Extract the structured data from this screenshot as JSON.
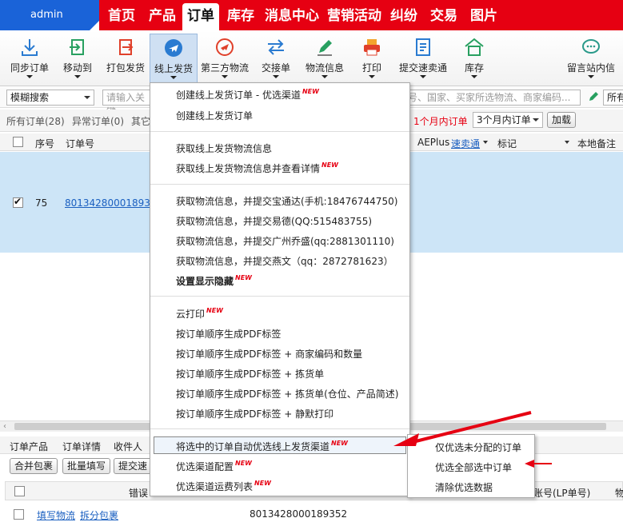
{
  "user": {
    "name": "admin"
  },
  "nav": [
    "首页",
    "产品",
    "订单",
    "库存",
    "消息中心",
    "营销活动",
    "纠纷",
    "交易",
    "图片"
  ],
  "toolbar": [
    {
      "label": "同步订单",
      "icon": "download-icon"
    },
    {
      "label": "移动到",
      "icon": "move-icon"
    },
    {
      "label": "打包发货",
      "icon": "export-icon"
    },
    {
      "label": "线上发货",
      "icon": "plane-icon"
    },
    {
      "label": "第三方物流",
      "icon": "plane-circle-icon"
    },
    {
      "label": "交接单",
      "icon": "exchange-icon"
    },
    {
      "label": "物流信息",
      "icon": "pencil-icon"
    },
    {
      "label": "打印",
      "icon": "printer-icon"
    },
    {
      "label": "提交速卖通",
      "icon": "document-icon"
    },
    {
      "label": "库存",
      "icon": "warehouse-icon"
    },
    {
      "label": "留言站内信",
      "icon": "chat-icon"
    }
  ],
  "filters": {
    "search_mode": "模糊搜索",
    "keyword_placeholder": "请输入关键",
    "keyword_hint_right": "号、国家、买家所选物流、商家编码...",
    "right_option": "所有",
    "tab_all": "所有订单(28)",
    "tab_abnormal": "异常订单(0)",
    "tab_other": "其它",
    "period_label": "1个月内订单",
    "period_select": "3个月内订单",
    "load_button": "加载"
  },
  "table": {
    "headers": {
      "seq": "序号",
      "order_no": "订单号",
      "aeplus": "AEPlus",
      "aeplus_link": "速卖通",
      "mark": "标记",
      "local_note": "本地备注"
    },
    "row": {
      "seq": "75",
      "order_no": "801342800018935"
    }
  },
  "menu": {
    "group1": [
      {
        "label": "创建线上发货订单 - 优选渠道",
        "new": "NEW"
      },
      {
        "label": "创建线上发货订单",
        "new": ""
      }
    ],
    "group2": [
      {
        "label": "获取线上发货物流信息",
        "new": ""
      },
      {
        "label": "获取线上发货物流信息并查看详情",
        "new": "NEW"
      }
    ],
    "group3": [
      {
        "label": "获取物流信息，并提交宝通达(手机:18476744750)",
        "new": ""
      },
      {
        "label": "获取物流信息，并提交易德(QQ:515483755)",
        "new": ""
      },
      {
        "label": "获取物流信息，并提交广州乔盛(qq:2881301110)",
        "new": ""
      },
      {
        "label": "获取物流信息，并提交燕文（qq：2872781623）",
        "new": ""
      },
      {
        "label": "设置显示隐藏",
        "new": "NEW"
      }
    ],
    "group4": [
      {
        "label": "云打印",
        "new": "NEW"
      },
      {
        "label": "按订单顺序生成PDF标签",
        "new": ""
      },
      {
        "label": "按订单顺序生成PDF标签 + 商家编码和数量",
        "new": ""
      },
      {
        "label": "按订单顺序生成PDF标签 + 拣货单",
        "new": ""
      },
      {
        "label": "按订单顺序生成PDF标签 + 拣货单(仓位、产品简述)",
        "new": ""
      },
      {
        "label": "按订单顺序生成PDF标签 + 静默打印",
        "new": ""
      }
    ],
    "group5": [
      {
        "label": "将选中的订单自动优选线上发货渠道",
        "new": "NEW"
      },
      {
        "label": "优选渠道配置",
        "new": "NEW"
      },
      {
        "label": "优选渠道运费列表",
        "new": "NEW"
      }
    ]
  },
  "submenu": [
    "仅优选未分配的订单",
    "优选全部选中订单",
    "清除优选数据"
  ],
  "bottom": {
    "tabs": [
      "订单产品",
      "订单详情",
      "收件人"
    ],
    "buttons": [
      "合并包裹",
      "批量填写",
      "提交速卖"
    ],
    "col_error": "错误",
    "col_account": "账号(LP单号)",
    "col_more": "物",
    "link_fill": "填写物流",
    "link_split": "拆分包裹",
    "order_no": "8013428000189352"
  }
}
